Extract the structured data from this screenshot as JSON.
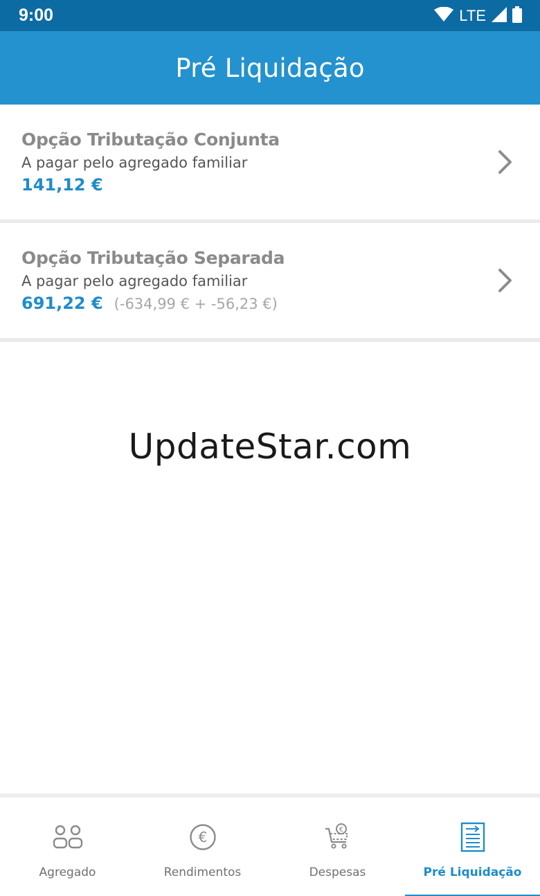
{
  "status_bar": {
    "time": "9:00",
    "network": "LTE",
    "icons": [
      "wifi-icon",
      "cell-signal-icon",
      "battery-icon"
    ]
  },
  "app_bar": {
    "title": "Pré Liquidação"
  },
  "options": [
    {
      "title": "Opção Tributação Conjunta",
      "subtitle": "A pagar pelo agregado familiar",
      "amount": "141,12 €",
      "detail": ""
    },
    {
      "title": "Opção Tributação Separada",
      "subtitle": "A pagar pelo agregado familiar",
      "amount": "691,22 €",
      "detail": "(-634,99 € + -56,23 €)"
    }
  ],
  "watermark": "UpdateStar.com",
  "bottom_nav": {
    "items": [
      {
        "label": "Agregado",
        "icon": "people-icon",
        "active": false
      },
      {
        "label": "Rendimentos",
        "icon": "euro-coin-icon",
        "active": false
      },
      {
        "label": "Despesas",
        "icon": "shopping-cart-euro-icon",
        "active": false
      },
      {
        "label": "Pré Liquidação",
        "icon": "document-arrow-icon",
        "active": true
      }
    ]
  },
  "colors": {
    "status_bar": "#0d6ba3",
    "app_bar": "#2392cf",
    "accent": "#1f8ccb",
    "title_gray": "#8a8a8a"
  }
}
